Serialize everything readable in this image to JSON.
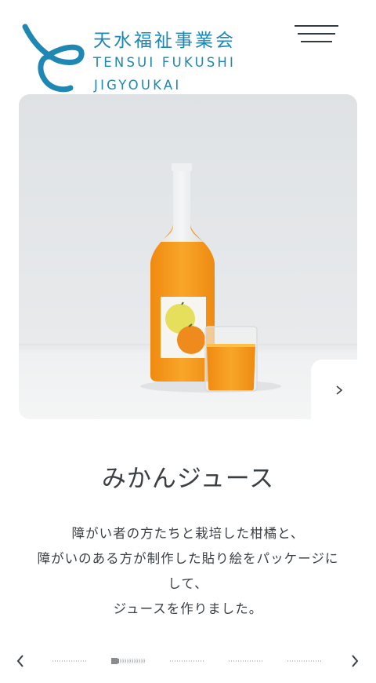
{
  "header": {
    "logo_jp": "天水福祉事業会",
    "logo_en_line1": "TENSUI FUKUSHI",
    "logo_en_line2": "JIGYOUKAI",
    "menu_icon": "hamburger-menu-icon"
  },
  "hero": {
    "image": "orange-juice-bottle-and-glass-photo",
    "next_icon": "chevron-right-icon"
  },
  "product": {
    "title": "みかんジュース",
    "description_lines": [
      "障がい者の方たちと栽培した柑橘と、",
      "障がいのある方が制作した貼り絵をパッケージに",
      "して、",
      "ジュースを作りました。"
    ]
  },
  "pager": {
    "prev_icon": "chevron-left-icon",
    "next_icon": "chevron-right-icon",
    "total_slides": 5,
    "active_index": 1
  },
  "colors": {
    "brand": "#1e87b3",
    "text": "#3a3f44",
    "juice": "#f39c1e"
  }
}
